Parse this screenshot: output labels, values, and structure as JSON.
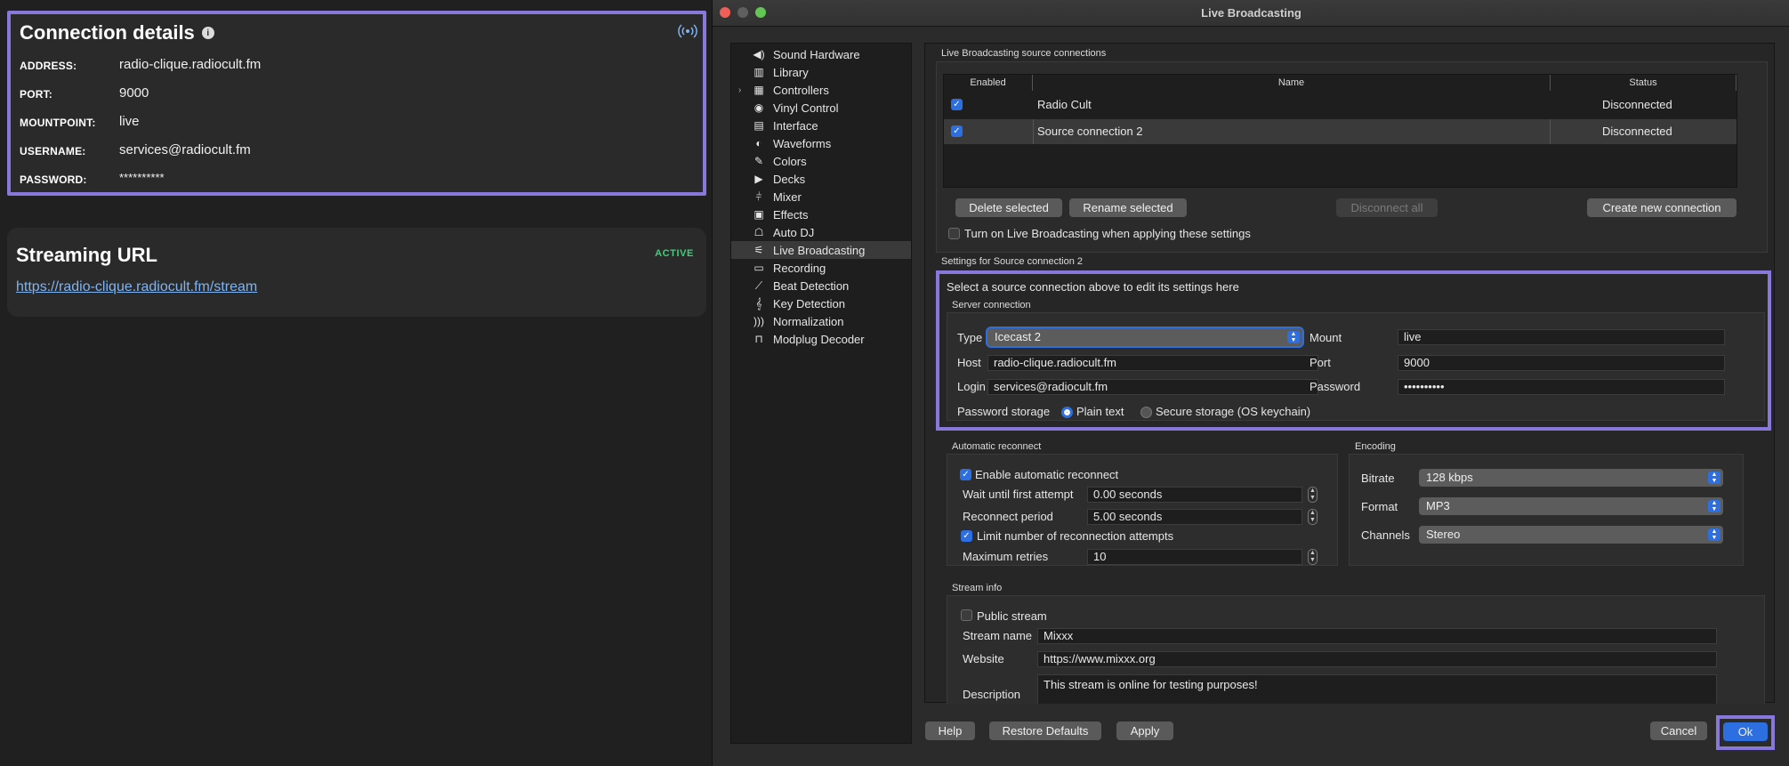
{
  "left": {
    "connection": {
      "title": "Connection details",
      "address_label": "ADDRESS:",
      "address": "radio-clique.radiocult.fm",
      "port_label": "PORT:",
      "port": "9000",
      "mount_label": "MOUNTPOINT:",
      "mount": "live",
      "user_label": "USERNAME:",
      "user": "services@radiocult.fm",
      "pass_label": "PASSWORD:",
      "pass": "**********"
    },
    "streaming": {
      "title": "Streaming URL",
      "badge": "ACTIVE",
      "url": "https://radio-clique.radiocult.fm/stream"
    }
  },
  "dialog": {
    "title": "Live Broadcasting",
    "sidebar": [
      {
        "label": "Sound Hardware",
        "icon": "speaker-icon"
      },
      {
        "label": "Library",
        "icon": "library-icon"
      },
      {
        "label": "Controllers",
        "icon": "controller-icon"
      },
      {
        "label": "Vinyl Control",
        "icon": "vinyl-icon"
      },
      {
        "label": "Interface",
        "icon": "interface-icon"
      },
      {
        "label": "Waveforms",
        "icon": "waveform-icon"
      },
      {
        "label": "Colors",
        "icon": "colors-icon"
      },
      {
        "label": "Decks",
        "icon": "play-icon"
      },
      {
        "label": "Mixer",
        "icon": "mixer-icon"
      },
      {
        "label": "Effects",
        "icon": "effects-icon"
      },
      {
        "label": "Auto DJ",
        "icon": "robot-icon"
      },
      {
        "label": "Live Broadcasting",
        "icon": "broadcast-icon"
      },
      {
        "label": "Recording",
        "icon": "recording-icon"
      },
      {
        "label": "Beat Detection",
        "icon": "beat-icon"
      },
      {
        "label": "Key Detection",
        "icon": "key-icon"
      },
      {
        "label": "Normalization",
        "icon": "normalization-icon"
      },
      {
        "label": "Modplug Decoder",
        "icon": "modplug-icon"
      }
    ],
    "sources": {
      "group_title": "Live Broadcasting source connections",
      "col_enabled": "Enabled",
      "col_name": "Name",
      "col_status": "Status",
      "rows": [
        {
          "name": "Radio Cult",
          "status": "Disconnected"
        },
        {
          "name": "Source connection 2",
          "status": "Disconnected"
        }
      ],
      "delete_btn": "Delete selected",
      "rename_btn": "Rename selected",
      "disconnect_btn": "Disconnect all",
      "create_btn": "Create new connection",
      "turn_on_label": "Turn on Live Broadcasting when applying these settings"
    },
    "settings": {
      "group_title": "Settings for Source connection 2",
      "hint": "Select a source connection above to edit its settings here",
      "server_title": "Server connection",
      "type_label": "Type",
      "type_value": "Icecast 2",
      "mount_label": "Mount",
      "mount_value": "live",
      "host_label": "Host",
      "host_value": "radio-clique.radiocult.fm",
      "port_label": "Port",
      "port_value": "9000",
      "login_label": "Login",
      "login_value": "services@radiocult.fm",
      "password_label": "Password",
      "password_value": "••••••••••",
      "storage_label": "Password storage",
      "plain_label": "Plain text",
      "secure_label": "Secure storage (OS keychain)"
    },
    "reconnect": {
      "title": "Automatic reconnect",
      "enable_label": "Enable automatic reconnect",
      "wait_label": "Wait until first attempt",
      "wait_value": "0.00 seconds",
      "period_label": "Reconnect period",
      "period_value": "5.00 seconds",
      "limit_label": "Limit number of reconnection attempts",
      "retries_label": "Maximum retries",
      "retries_value": "10"
    },
    "encoding": {
      "title": "Encoding",
      "bitrate_label": "Bitrate",
      "bitrate_value": "128 kbps",
      "format_label": "Format",
      "format_value": "MP3",
      "channels_label": "Channels",
      "channels_value": "Stereo"
    },
    "stream_info": {
      "title": "Stream info",
      "public_label": "Public stream",
      "name_label": "Stream name",
      "name_value": "Mixxx",
      "website_label": "Website",
      "website_value": "https://www.mixxx.org",
      "desc_label": "Description",
      "desc_value": "This stream is online for testing purposes!"
    },
    "footer": {
      "help": "Help",
      "restore": "Restore Defaults",
      "apply": "Apply",
      "cancel": "Cancel",
      "ok": "Ok"
    }
  },
  "colors": {
    "accent": "#2d6fe0",
    "highlight": "#8878dc",
    "active": "#3ecf7a",
    "link": "#7fb4f2"
  }
}
